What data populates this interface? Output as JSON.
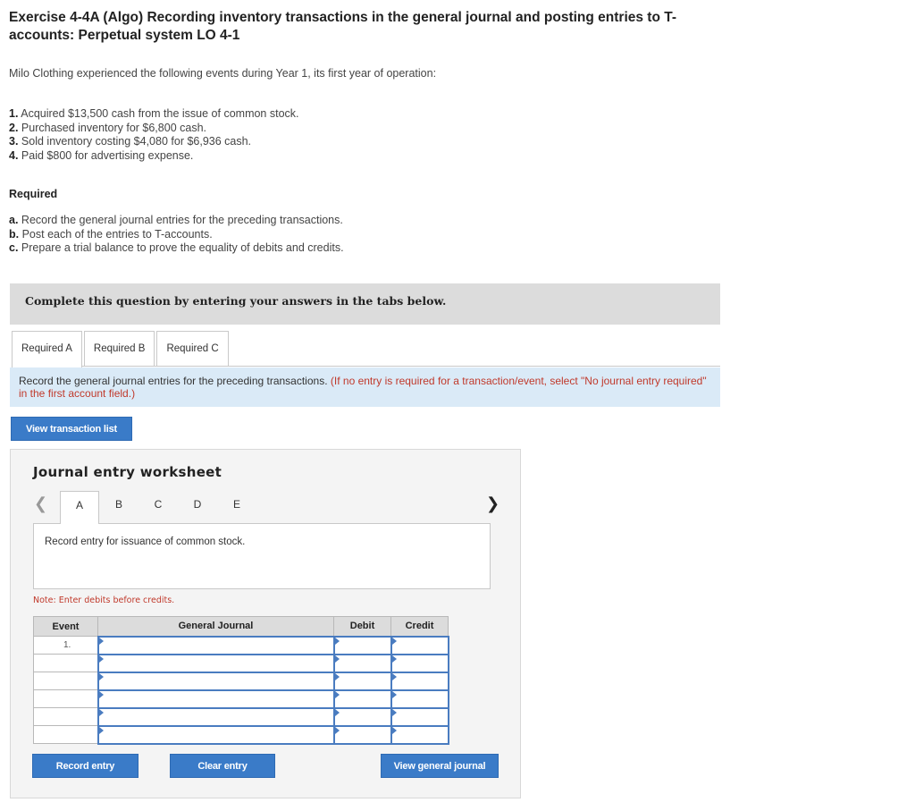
{
  "header": {
    "title": "Exercise 4-4A (Algo) Recording inventory transactions in the general journal and posting entries to T-accounts: Perpetual system LO 4-1",
    "intro": "Milo Clothing experienced the following events during Year 1, its first year of operation:"
  },
  "events": [
    {
      "num": "1.",
      "text": "Acquired $13,500 cash from the issue of common stock."
    },
    {
      "num": "2.",
      "text": "Purchased inventory for $6,800 cash."
    },
    {
      "num": "3.",
      "text": "Sold inventory costing $4,080 for $6,936 cash."
    },
    {
      "num": "4.",
      "text": "Paid $800 for advertising expense."
    }
  ],
  "required": {
    "heading": "Required",
    "items": [
      {
        "letter": "a.",
        "text": "Record the general journal entries for the preceding transactions."
      },
      {
        "letter": "b.",
        "text": "Post each of the entries to T-accounts."
      },
      {
        "letter": "c.",
        "text": "Prepare a trial balance to prove the equality of debits and credits."
      }
    ]
  },
  "complete_bar": "Complete this question by entering your answers in the tabs below.",
  "tabs": [
    "Required A",
    "Required B",
    "Required C"
  ],
  "instruction": {
    "text": "Record the general journal entries for the preceding transactions.",
    "note": "(If no entry is required for a transaction/event, select \"No journal entry required\" in the first account field.)"
  },
  "view_transaction_list": "View transaction list",
  "worksheet": {
    "title": "Journal entry worksheet",
    "letters": [
      "A",
      "B",
      "C",
      "D",
      "E"
    ],
    "entry_description": "Record entry for issuance of common stock.",
    "note": "Note: Enter debits before credits.",
    "table": {
      "headers": {
        "event": "Event",
        "journal": "General Journal",
        "debit": "Debit",
        "credit": "Credit"
      },
      "event_number": "1."
    },
    "buttons": {
      "record": "Record entry",
      "clear": "Clear entry",
      "view_journal": "View general journal"
    }
  },
  "colors": {
    "accent_blue": "#3a7bc8",
    "note_red": "#c0392b",
    "instruction_bg": "#daeaf7"
  },
  "icons": [
    "chevron-left-icon",
    "chevron-right-icon"
  ]
}
